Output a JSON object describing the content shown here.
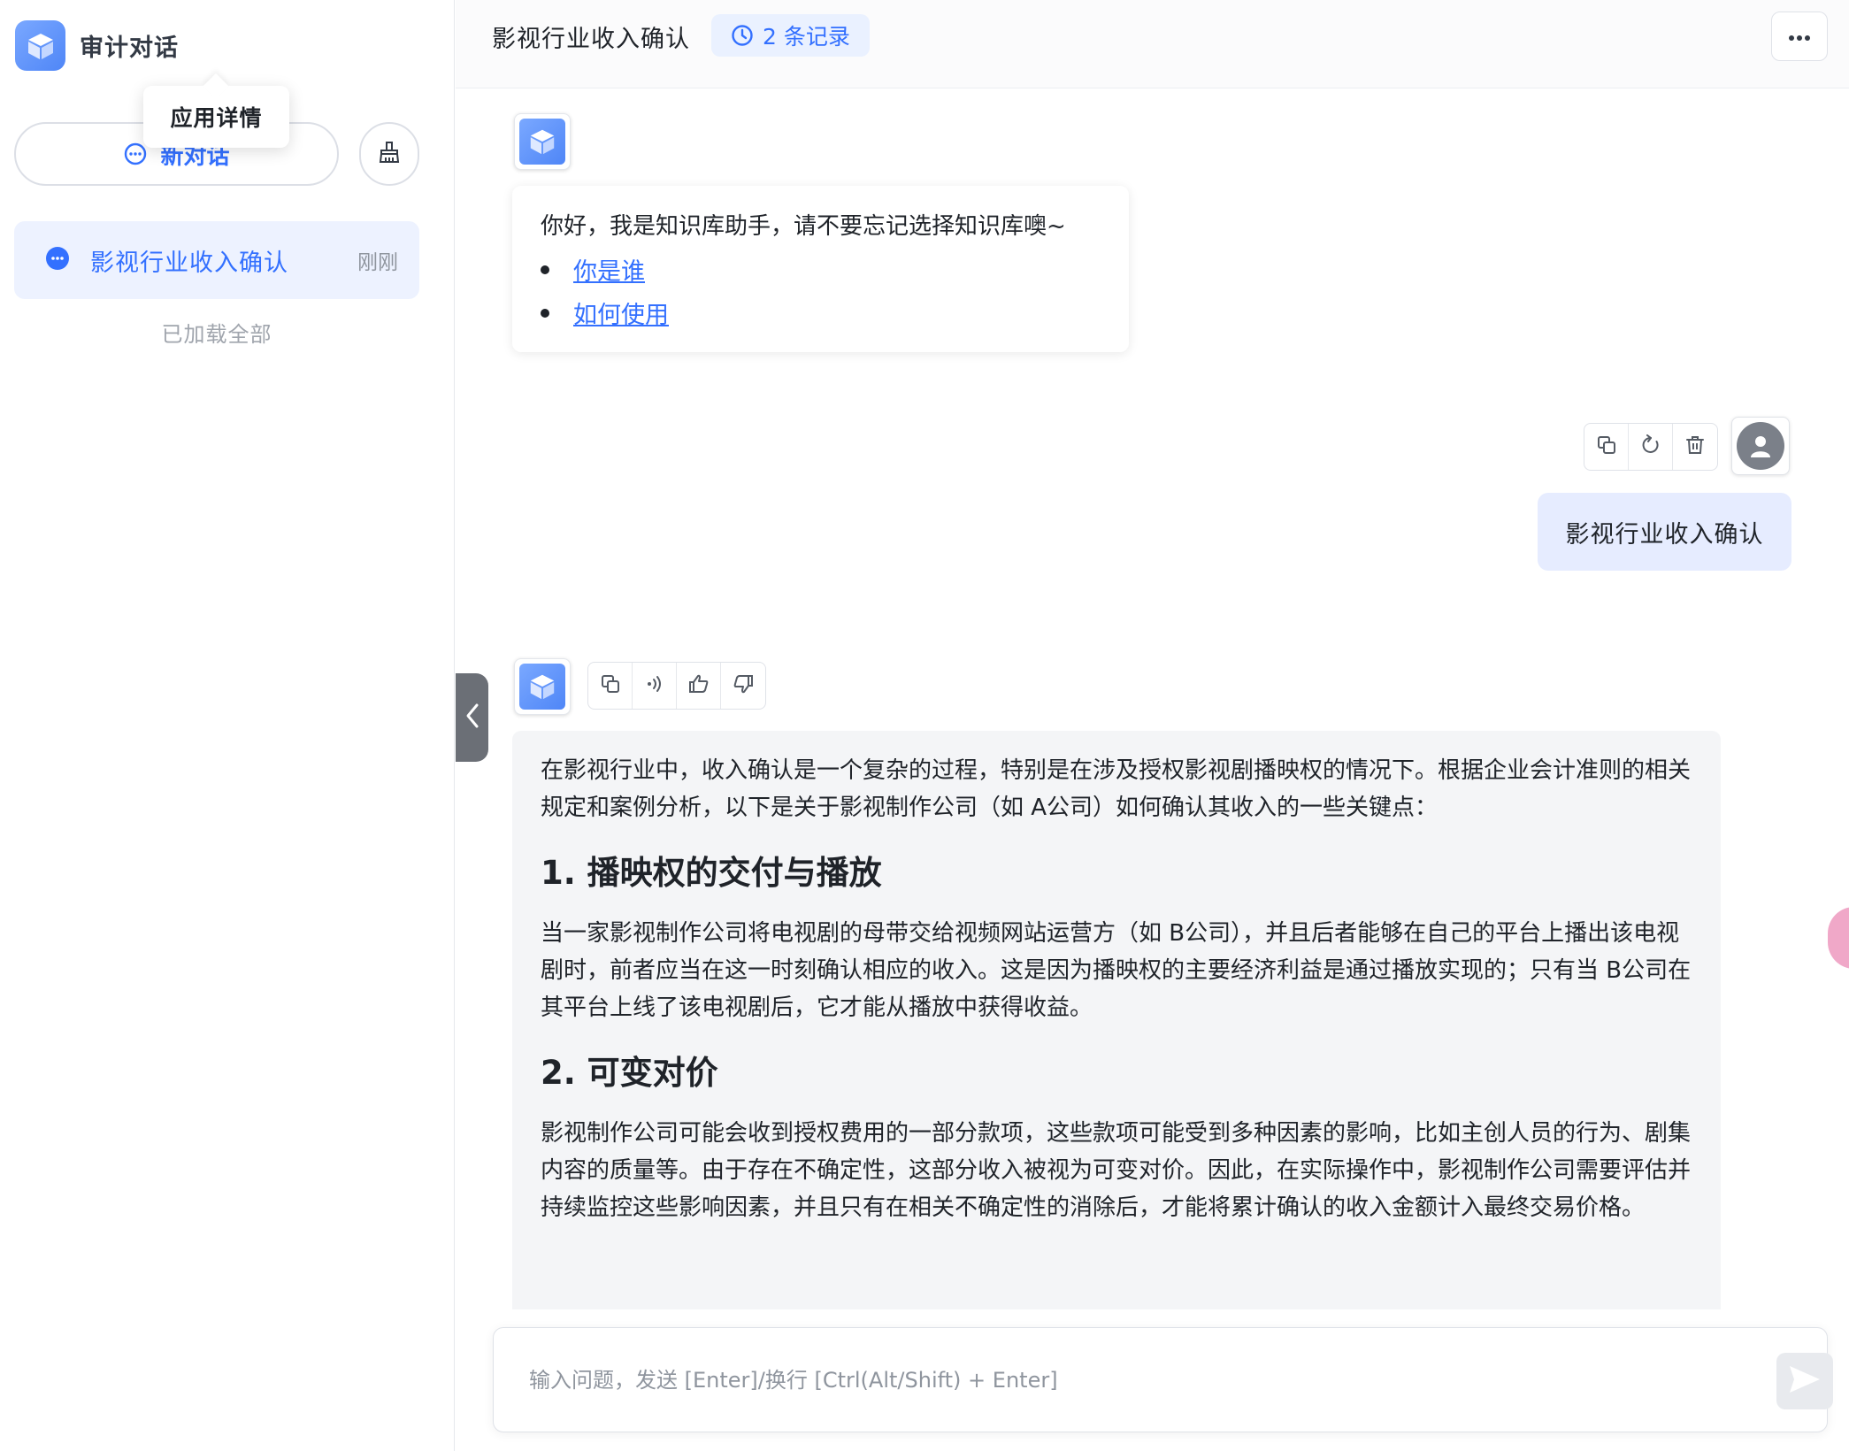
{
  "sidebar": {
    "app_title": "审计对话",
    "tooltip": "应用详情",
    "new_chat_label": "新对话",
    "history": [
      {
        "label": "影视行业收入确认",
        "time": "刚刚"
      }
    ],
    "loaded_all": "已加载全部"
  },
  "header": {
    "title": "影视行业收入确认",
    "record_count": "2 条记录"
  },
  "chat": {
    "welcome": {
      "greeting": "你好，我是知识库助手，请不要忘记选择知识库噢~",
      "links": [
        "你是谁",
        "如何使用"
      ]
    },
    "user_message": "影视行业收入确认",
    "answer": {
      "intro": "在影视行业中，收入确认是一个复杂的过程，特别是在涉及授权影视剧播映权的情况下。根据企业会计准则的相关规定和案例分析，以下是关于影视制作公司（如 A公司）如何确认其收入的一些关键点：",
      "sections": [
        {
          "heading": "1. 播映权的交付与播放",
          "body": "当一家影视制作公司将电视剧的母带交给视频网站运营方（如 B公司），并且后者能够在自己的平台上播出该电视剧时，前者应当在这一时刻确认相应的收入。这是因为播映权的主要经济利益是通过播放实现的；只有当 B公司在其平台上线了该电视剧后，它才能从播放中获得收益。"
        },
        {
          "heading": "2. 可变对价",
          "body": "影视制作公司可能会收到授权费用的一部分款项，这些款项可能受到多种因素的影响，比如主创人员的行为、剧集内容的质量等。由于存在不确定性，这部分收入被视为可变对价。因此，在实际操作中，影视制作公司需要评估并持续监控这些影响因素，并且只有在相关不确定性的消除后，才能将累计确认的收入金额计入最终交易价格。"
        }
      ]
    }
  },
  "input": {
    "placeholder": "输入问题，发送 [Enter]/换行 [Ctrl(Alt/Shift) + Enter]"
  },
  "colors": {
    "accent": "#3370ff",
    "user_bubble": "#e6ecff",
    "answer_bg": "#f4f5f7"
  }
}
